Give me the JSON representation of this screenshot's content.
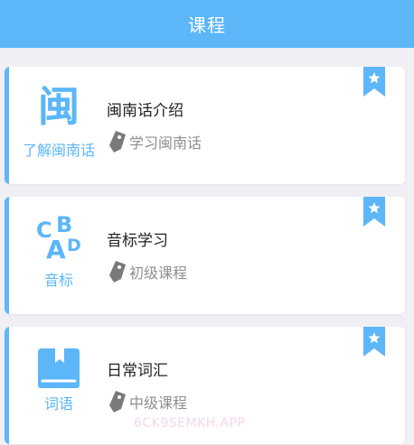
{
  "header": {
    "title": "课程"
  },
  "courses": [
    {
      "icon": "min-character-icon",
      "icon_label": "了解闽南话",
      "title": "闽南话介绍",
      "tag_icon": "tag-icon",
      "tag": "学习闽南话",
      "bookmark_icon": "star-bookmark-icon"
    },
    {
      "icon": "abcd-letters-icon",
      "icon_glyphs": {
        "c": "C",
        "a": "A",
        "b": "B",
        "d": "D"
      },
      "icon_label": "音标",
      "title": "音标学习",
      "tag_icon": "tag-icon",
      "tag": "初级课程",
      "bookmark_icon": "star-bookmark-icon"
    },
    {
      "icon": "book-icon",
      "icon_label": "词语",
      "title": "日常词汇",
      "tag_icon": "tag-icon",
      "tag": "中级课程",
      "bookmark_icon": "star-bookmark-icon"
    }
  ],
  "watermark": {
    "text": "6CK9SEMKH.APP"
  },
  "colors": {
    "accent": "#5cb6f8",
    "background": "#efeff4",
    "title_text": "#222222",
    "tag_text": "#8e8e8e",
    "tag_icon": "#7a7a7a"
  }
}
